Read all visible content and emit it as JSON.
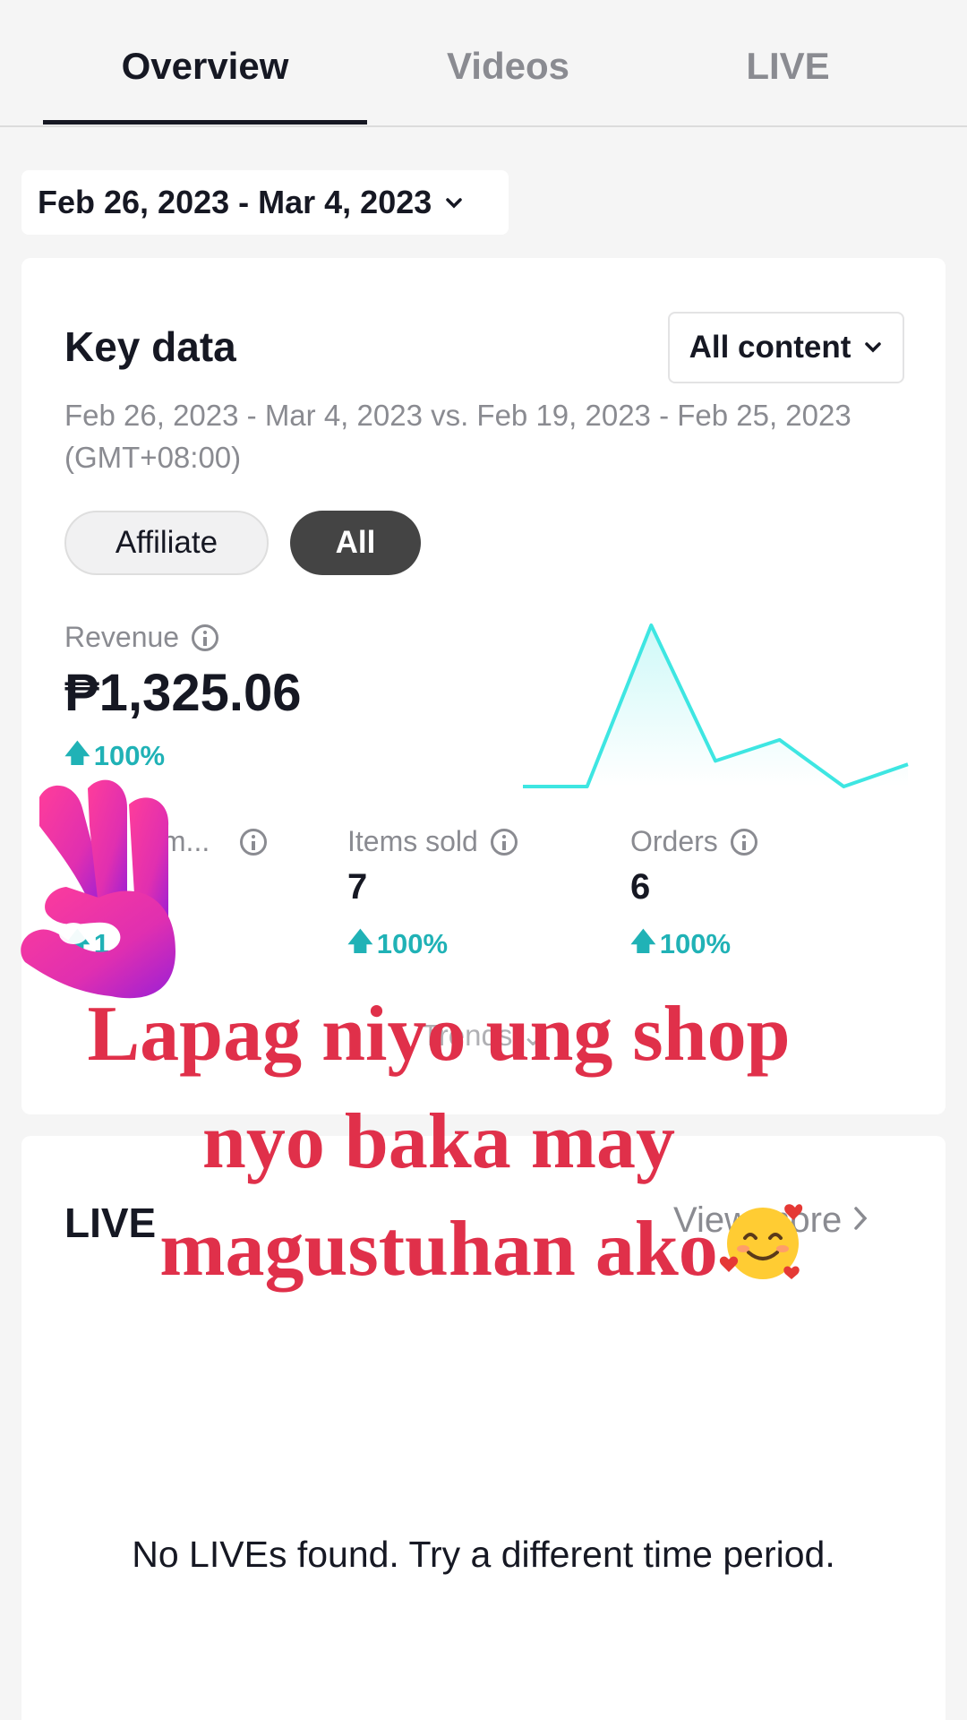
{
  "tabs": [
    {
      "label": "Overview",
      "active": true
    },
    {
      "label": "Videos",
      "active": false
    },
    {
      "label": "LIVE",
      "active": false
    }
  ],
  "date_picker": {
    "value": "Feb 26, 2023 - Mar 4, 2023"
  },
  "key_data": {
    "title": "Key data",
    "content_filter": "All content",
    "date_compare": "Feb 26, 2023 - Mar 4, 2023 vs. Feb 19, 2023 - Feb 25, 2023 (GMT+08:00)",
    "pills": {
      "affiliate": "Affiliate",
      "all": "All",
      "selected": "All"
    },
    "revenue": {
      "label": "Revenue",
      "value": "₱1,325.06",
      "delta": "100%"
    },
    "metrics": [
      {
        "label": "Im...",
        "value": "",
        "delta": "1"
      },
      {
        "label": "Items sold",
        "value": "7",
        "delta": "100%"
      },
      {
        "label": "Orders",
        "value": "6",
        "delta": "100%"
      }
    ],
    "trends_label": "Trends",
    "sparkline": {
      "color": "#3ee6e2",
      "values": [
        0,
        0,
        14.5,
        2.3,
        4.2,
        0,
        2
      ]
    }
  },
  "live": {
    "title": "LIVE",
    "view_more": "View more",
    "empty_message": "No LIVEs found. Try a different time period."
  },
  "overlay": {
    "lines": [
      "Lapag niyo ung shop",
      "nyo baka may",
      "magustuhan ako"
    ],
    "color": "#e0304a",
    "sticker": "ok-hand-icon",
    "emoji": "smiling-face-with-hearts-icon"
  }
}
